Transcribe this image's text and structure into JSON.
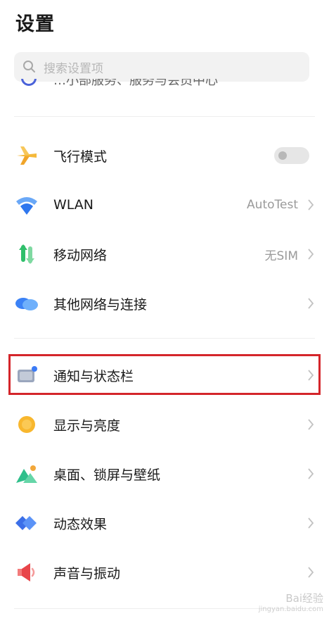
{
  "header": {
    "title": "设置"
  },
  "search": {
    "placeholder": "搜索设置项"
  },
  "partial_row": {
    "text": "…小部服务、服务与会员中心"
  },
  "items": [
    {
      "label": "飞行模式",
      "value": "",
      "icon": "airplane-icon"
    },
    {
      "label": "WLAN",
      "value": "AutoTest",
      "icon": "wifi-icon"
    },
    {
      "label": "移动网络",
      "value": "无SIM",
      "icon": "mobile-network-icon"
    },
    {
      "label": "其他网络与连接",
      "value": "",
      "icon": "cloud-icon"
    },
    {
      "label": "通知与状态栏",
      "value": "",
      "icon": "notification-icon"
    },
    {
      "label": "显示与亮度",
      "value": "",
      "icon": "brightness-icon"
    },
    {
      "label": "桌面、锁屏与壁纸",
      "value": "",
      "icon": "wallpaper-icon"
    },
    {
      "label": "动态效果",
      "value": "",
      "icon": "animation-icon"
    },
    {
      "label": "声音与振动",
      "value": "",
      "icon": "speaker-icon"
    }
  ],
  "watermark": {
    "main": "Bai经验",
    "sub": "jingyan.baidu.com"
  },
  "colors": {
    "accent_blue": "#3b7bf6",
    "highlight_red": "#d4252a",
    "toggle_off": "#e6e6e6"
  }
}
